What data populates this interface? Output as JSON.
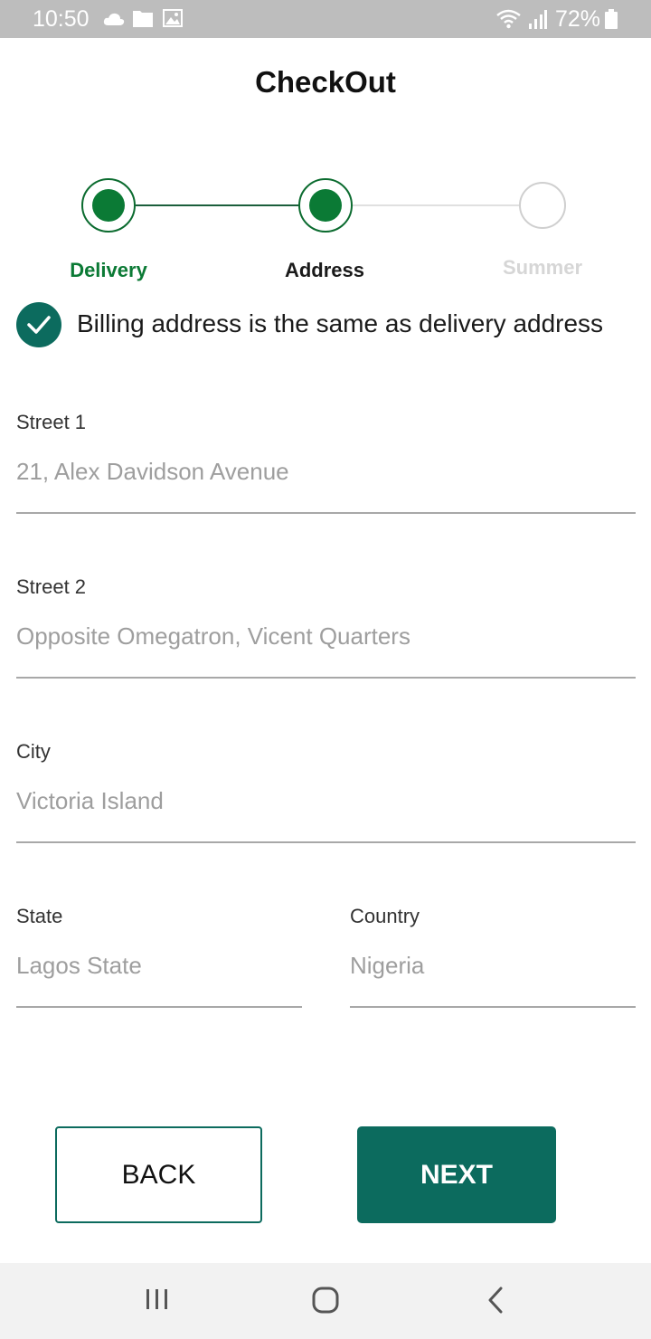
{
  "status_bar": {
    "time": "10:50",
    "battery": "72%",
    "icons": [
      "cloud-icon",
      "folder-icon",
      "gallery-icon",
      "wifi-icon",
      "signal-icon",
      "battery-icon"
    ]
  },
  "header": {
    "title": "CheckOut"
  },
  "stepper": {
    "steps": [
      {
        "label": "Delivery",
        "state": "completed"
      },
      {
        "label": "Address",
        "state": "current"
      },
      {
        "label": "Summer",
        "state": "upcoming"
      }
    ],
    "colors": {
      "active": "#0b7a35",
      "inactive": "#d6d6d6"
    }
  },
  "billing": {
    "same_as_delivery_label": "Billing address is the same as delivery address",
    "checked": true
  },
  "form": {
    "street1": {
      "label": "Street 1",
      "value": "21, Alex Davidson Avenue"
    },
    "street2": {
      "label": "Street 2",
      "value": "Opposite Omegatron, Vicent Quarters"
    },
    "city": {
      "label": "City",
      "value": "Victoria Island"
    },
    "state": {
      "label": "State",
      "value": "Lagos State"
    },
    "country": {
      "label": "Country",
      "value": "Nigeria"
    }
  },
  "actions": {
    "back_label": "BACK",
    "next_label": "NEXT",
    "accent": "#0c6b5e"
  },
  "nav_bar": {
    "icons": [
      "recents-icon",
      "home-icon",
      "back-icon"
    ]
  }
}
